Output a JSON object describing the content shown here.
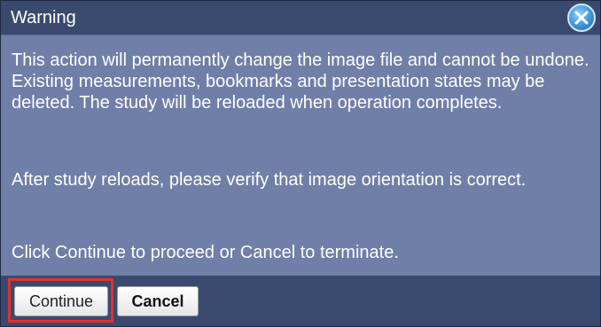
{
  "dialog": {
    "title": "Warning",
    "close_icon": "close-icon",
    "message_paragraphs": [
      "This action will permanently change the image file and cannot be undone. Existing measurements, bookmarks and presentation states may be deleted. The study will be reloaded when operation completes.",
      "After study reloads, please verify that image orientation is correct.",
      "Click Continue to proceed or Cancel to terminate."
    ],
    "buttons": {
      "continue_label": "Continue",
      "cancel_label": "Cancel"
    }
  },
  "colors": {
    "title_bar": "#3a4a6e",
    "content_background": "#6f7fa8",
    "highlight": "#e0312f",
    "close_button": "#3d94d8"
  }
}
